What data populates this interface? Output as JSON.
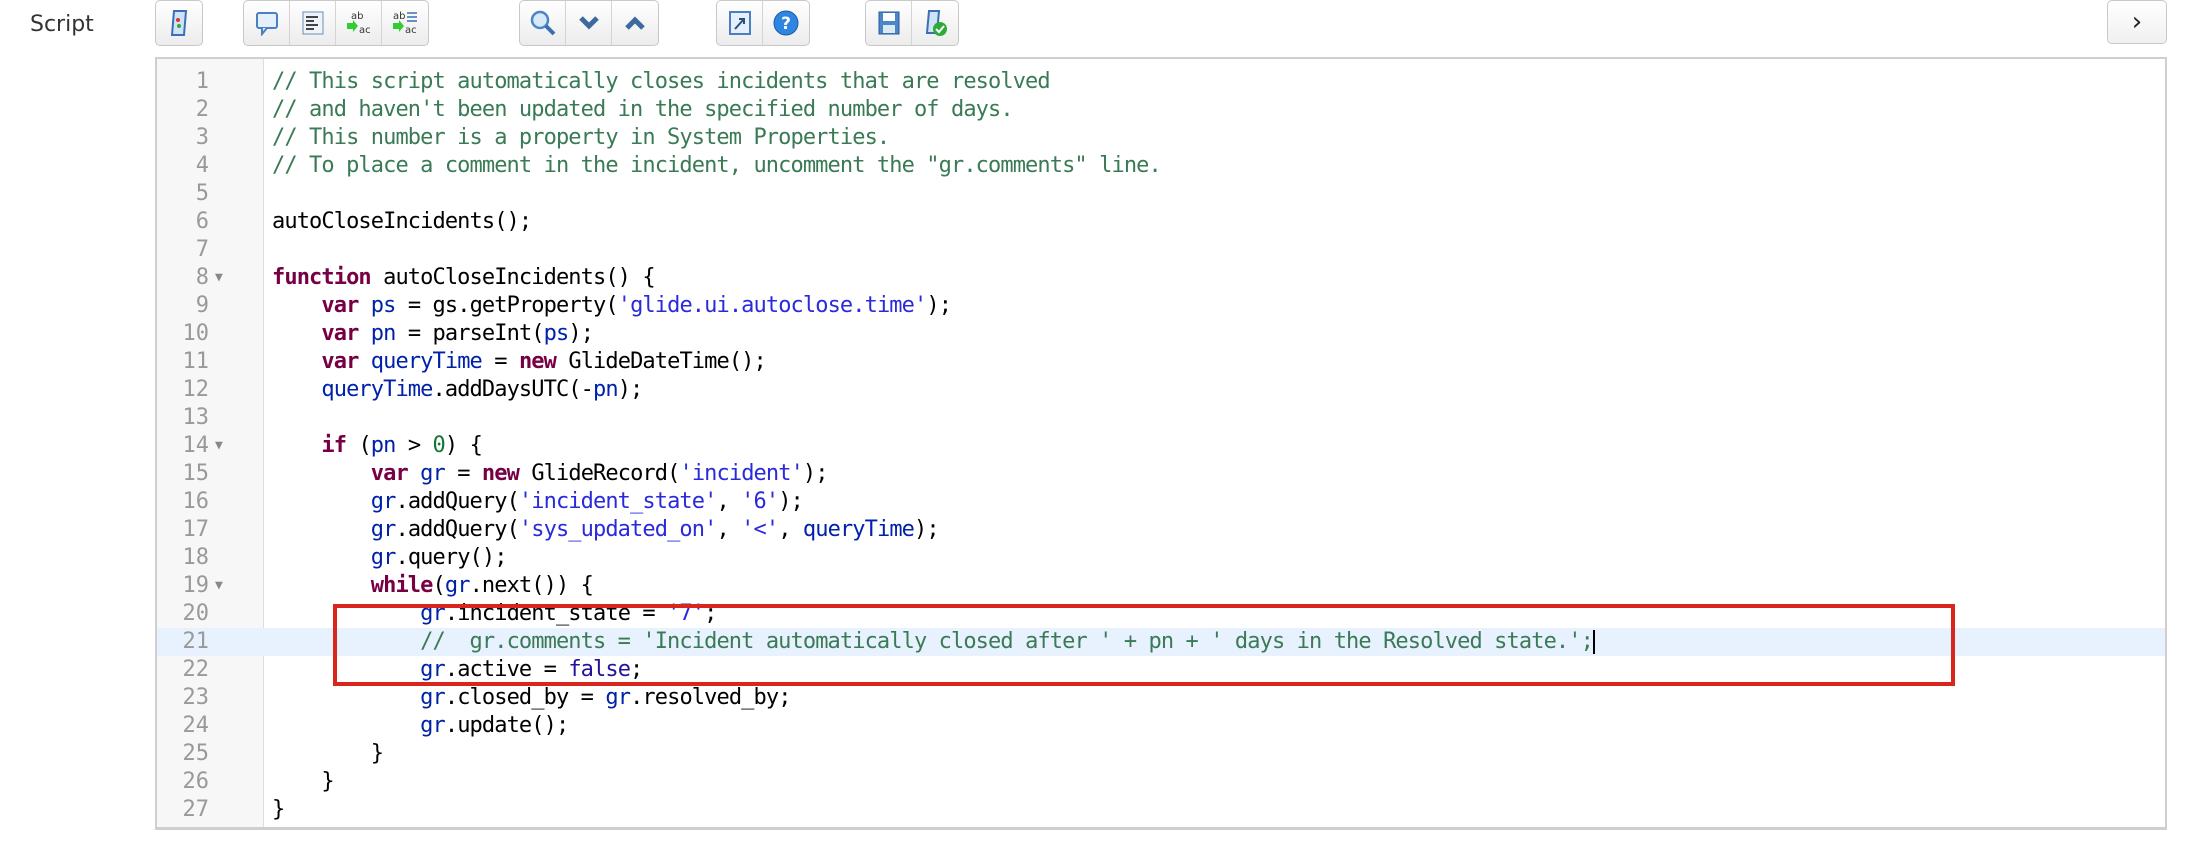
{
  "field_label": "Script",
  "toolbar": {
    "groups": [
      [
        "toggle-syntax-editor"
      ],
      [
        "comment",
        "format-code",
        "replace",
        "replace-all"
      ],
      [
        "search",
        "next-match",
        "previous-match"
      ],
      [
        "fullscreen",
        "help"
      ],
      [
        "save",
        "check-syntax"
      ]
    ],
    "next_label": "›"
  },
  "colors": {
    "comment": "#3a7a55",
    "keyword": "#770044",
    "variable": "#0022aa",
    "string": "#2a2adb",
    "highlight": "#e8f2ff",
    "annotation": "#d9261c"
  },
  "code": {
    "active_line": 21,
    "lines": [
      {
        "n": "1",
        "tokens": [
          [
            "c",
            "// This script automatically closes incidents that are resolved"
          ]
        ]
      },
      {
        "n": "2",
        "tokens": [
          [
            "c",
            "// and haven't been updated in the specified number of days."
          ]
        ]
      },
      {
        "n": "3",
        "tokens": [
          [
            "c",
            "// This number is a property in System Properties."
          ]
        ]
      },
      {
        "n": "4",
        "tokens": [
          [
            "c",
            "// To place a comment in the incident, uncomment the \"gr.comments\" line."
          ]
        ]
      },
      {
        "n": "5",
        "tokens": []
      },
      {
        "n": "6",
        "tokens": [
          [
            "p",
            "autoCloseIncidents();"
          ]
        ]
      },
      {
        "n": "7",
        "tokens": []
      },
      {
        "n": "8",
        "fold": true,
        "tokens": [
          [
            "k",
            "function"
          ],
          [
            "p",
            " autoCloseIncidents() {"
          ]
        ]
      },
      {
        "n": "9",
        "tokens": [
          [
            "p",
            "    "
          ],
          [
            "k",
            "var"
          ],
          [
            "p",
            " "
          ],
          [
            "v",
            "ps"
          ],
          [
            "p",
            " = gs.getProperty("
          ],
          [
            "s",
            "'glide.ui.autoclose.time'"
          ],
          [
            "p",
            ");"
          ]
        ]
      },
      {
        "n": "10",
        "tokens": [
          [
            "p",
            "    "
          ],
          [
            "k",
            "var"
          ],
          [
            "p",
            " "
          ],
          [
            "v",
            "pn"
          ],
          [
            "p",
            " = parseInt("
          ],
          [
            "v",
            "ps"
          ],
          [
            "p",
            ");"
          ]
        ]
      },
      {
        "n": "11",
        "tokens": [
          [
            "p",
            "    "
          ],
          [
            "k",
            "var"
          ],
          [
            "p",
            " "
          ],
          [
            "v",
            "queryTime"
          ],
          [
            "p",
            " = "
          ],
          [
            "k",
            "new"
          ],
          [
            "p",
            " GlideDateTime();"
          ]
        ]
      },
      {
        "n": "12",
        "tokens": [
          [
            "p",
            "    "
          ],
          [
            "v",
            "queryTime"
          ],
          [
            "p",
            ".addDaysUTC(-"
          ],
          [
            "v",
            "pn"
          ],
          [
            "p",
            ");"
          ]
        ]
      },
      {
        "n": "13",
        "tokens": []
      },
      {
        "n": "14",
        "fold": true,
        "tokens": [
          [
            "p",
            "    "
          ],
          [
            "k",
            "if"
          ],
          [
            "p",
            " ("
          ],
          [
            "v",
            "pn"
          ],
          [
            "p",
            " > "
          ],
          [
            "n",
            "0"
          ],
          [
            "p",
            ") {"
          ]
        ]
      },
      {
        "n": "15",
        "tokens": [
          [
            "p",
            "        "
          ],
          [
            "k",
            "var"
          ],
          [
            "p",
            " "
          ],
          [
            "v",
            "gr"
          ],
          [
            "p",
            " = "
          ],
          [
            "k",
            "new"
          ],
          [
            "p",
            " GlideRecord("
          ],
          [
            "s",
            "'incident'"
          ],
          [
            "p",
            ");"
          ]
        ]
      },
      {
        "n": "16",
        "tokens": [
          [
            "p",
            "        "
          ],
          [
            "v",
            "gr"
          ],
          [
            "p",
            ".addQuery("
          ],
          [
            "s",
            "'incident_state'"
          ],
          [
            "p",
            ", "
          ],
          [
            "s",
            "'6'"
          ],
          [
            "p",
            ");"
          ]
        ]
      },
      {
        "n": "17",
        "tokens": [
          [
            "p",
            "        "
          ],
          [
            "v",
            "gr"
          ],
          [
            "p",
            ".addQuery("
          ],
          [
            "s",
            "'sys_updated_on'"
          ],
          [
            "p",
            ", "
          ],
          [
            "s",
            "'<'"
          ],
          [
            "p",
            ", "
          ],
          [
            "v",
            "queryTime"
          ],
          [
            "p",
            ");"
          ]
        ]
      },
      {
        "n": "18",
        "tokens": [
          [
            "p",
            "        "
          ],
          [
            "v",
            "gr"
          ],
          [
            "p",
            ".query();"
          ]
        ]
      },
      {
        "n": "19",
        "fold": true,
        "tokens": [
          [
            "p",
            "        "
          ],
          [
            "k",
            "while"
          ],
          [
            "p",
            "("
          ],
          [
            "v",
            "gr"
          ],
          [
            "p",
            ".next()) {"
          ]
        ]
      },
      {
        "n": "20",
        "tokens": [
          [
            "p",
            "            "
          ],
          [
            "v",
            "gr"
          ],
          [
            "p",
            ".incident_state = "
          ],
          [
            "s",
            "'7'"
          ],
          [
            "p",
            ";"
          ]
        ]
      },
      {
        "n": "21",
        "tokens": [
          [
            "p",
            "            "
          ],
          [
            "c",
            "//  gr.comments = 'Incident automatically closed after ' + pn + ' days in the Resolved state.';"
          ]
        ]
      },
      {
        "n": "22",
        "tokens": [
          [
            "p",
            "            "
          ],
          [
            "v",
            "gr"
          ],
          [
            "p",
            ".active = "
          ],
          [
            "a",
            "false"
          ],
          [
            "p",
            ";"
          ]
        ]
      },
      {
        "n": "23",
        "tokens": [
          [
            "p",
            "            "
          ],
          [
            "v",
            "gr"
          ],
          [
            "p",
            ".closed_by = "
          ],
          [
            "v",
            "gr"
          ],
          [
            "p",
            ".resolved_by;"
          ]
        ]
      },
      {
        "n": "24",
        "tokens": [
          [
            "p",
            "            "
          ],
          [
            "v",
            "gr"
          ],
          [
            "p",
            ".update();"
          ]
        ]
      },
      {
        "n": "25",
        "tokens": [
          [
            "p",
            "        }"
          ]
        ]
      },
      {
        "n": "26",
        "tokens": [
          [
            "p",
            "    }"
          ]
        ]
      },
      {
        "n": "27",
        "tokens": [
          [
            "p",
            "}"
          ]
        ]
      }
    ]
  }
}
